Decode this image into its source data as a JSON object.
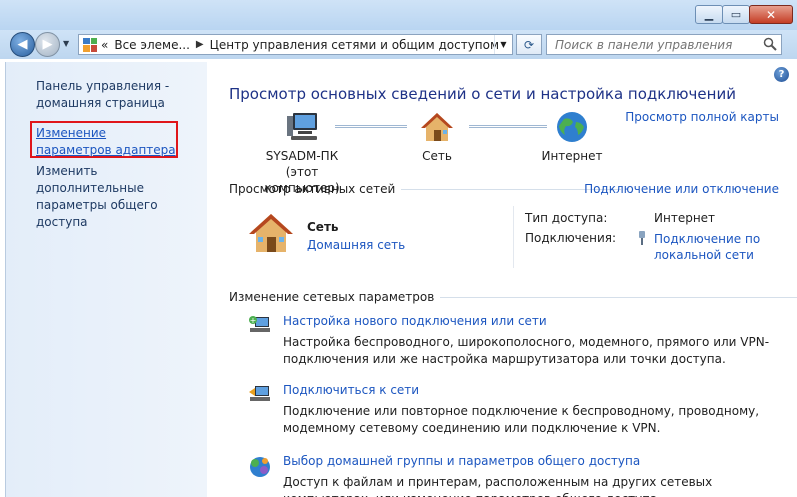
{
  "nav": {
    "breadcrumb_prefix": "«",
    "breadcrumb_1": "Все элеме...",
    "breadcrumb_2": "Центр управления сетями и общим доступом",
    "search_placeholder": "Поиск в панели управления"
  },
  "sidebar": {
    "home_link": "Панель управления - домашняя страница",
    "adapter_link": "Изменение параметров адаптера",
    "sharing_link": "Изменить дополнительные параметры общего доступа"
  },
  "main": {
    "title": "Просмотр основных сведений о сети и настройка подключений",
    "full_map_link": "Просмотр полной карты",
    "node_pc_name": "SYSADM-ПК",
    "node_pc_sub": "(этот компьютер)",
    "node_net": "Сеть",
    "node_internet": "Интернет",
    "active_header": "Просмотр активных сетей",
    "connect_disconnect_link": "Подключение или отключение",
    "active_net_name": "Сеть",
    "active_net_type": "Домашняя сеть",
    "access_type_label": "Тип доступа:",
    "access_type_value": "Интернет",
    "connections_label": "Подключения:",
    "connections_value": "Подключение по локальной сети",
    "change_header": "Изменение сетевых параметров",
    "tasks": [
      {
        "link": "Настройка нового подключения или сети",
        "desc": "Настройка беспроводного, широкополосного, модемного, прямого или VPN-подключения или же настройка маршрутизатора или точки доступа."
      },
      {
        "link": "Подключиться к сети",
        "desc": "Подключение или повторное подключение к беспроводному, проводному, модемному сетевому соединению или подключение к VPN."
      },
      {
        "link": "Выбор домашней группы и параметров общего доступа",
        "desc": "Доступ к файлам и принтерам, расположенным на других сетевых компьютерах, или изменение параметров общего доступа."
      }
    ]
  },
  "colors": {
    "link": "#1c56c0",
    "title": "#1e3287",
    "highlight": "#e0161a"
  }
}
